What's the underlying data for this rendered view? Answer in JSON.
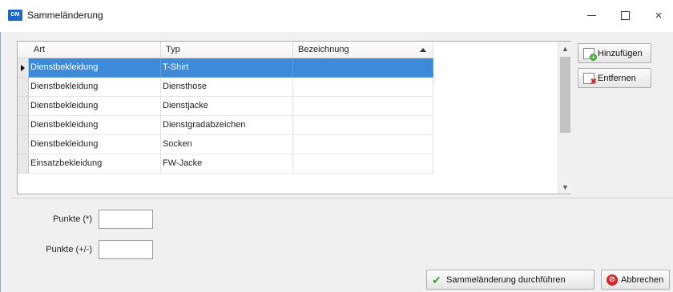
{
  "window": {
    "app_icon": "DM",
    "title": "Sammeländerung",
    "minimize": "",
    "maximize": "",
    "close": "×"
  },
  "grid": {
    "columns": [
      "Art",
      "Typ",
      "Bezeichnung"
    ],
    "sorted_column": "Bezeichnung",
    "rows": [
      {
        "art": "Dienstbekleidung",
        "typ": "T-Shirt",
        "bezeichnung": "",
        "selected": true
      },
      {
        "art": "Dienstbekleidung",
        "typ": "Diensthose",
        "bezeichnung": ""
      },
      {
        "art": "Dienstbekleidung",
        "typ": "Dienstjacke",
        "bezeichnung": ""
      },
      {
        "art": "Dienstbekleidung",
        "typ": "Dienstgradabzeichen",
        "bezeichnung": ""
      },
      {
        "art": "Dienstbekleidung",
        "typ": "Socken",
        "bezeichnung": ""
      },
      {
        "art": "Einsatzbekleidung",
        "typ": "FW-Jacke",
        "bezeichnung": ""
      }
    ]
  },
  "side_buttons": {
    "add_label": "Hinzufügen",
    "remove_label": "Entfernen"
  },
  "form": {
    "points_label": "Punkte (*)",
    "points_value": "",
    "points_delta_label": "Punkte (+/-)",
    "points_delta_value": ""
  },
  "footer": {
    "execute_label": "Sammeländerung durchführen",
    "cancel_label": "Abbrechen"
  },
  "colors": {
    "selection": "#3c8ad8",
    "window_bg": "#f0f0f0"
  }
}
